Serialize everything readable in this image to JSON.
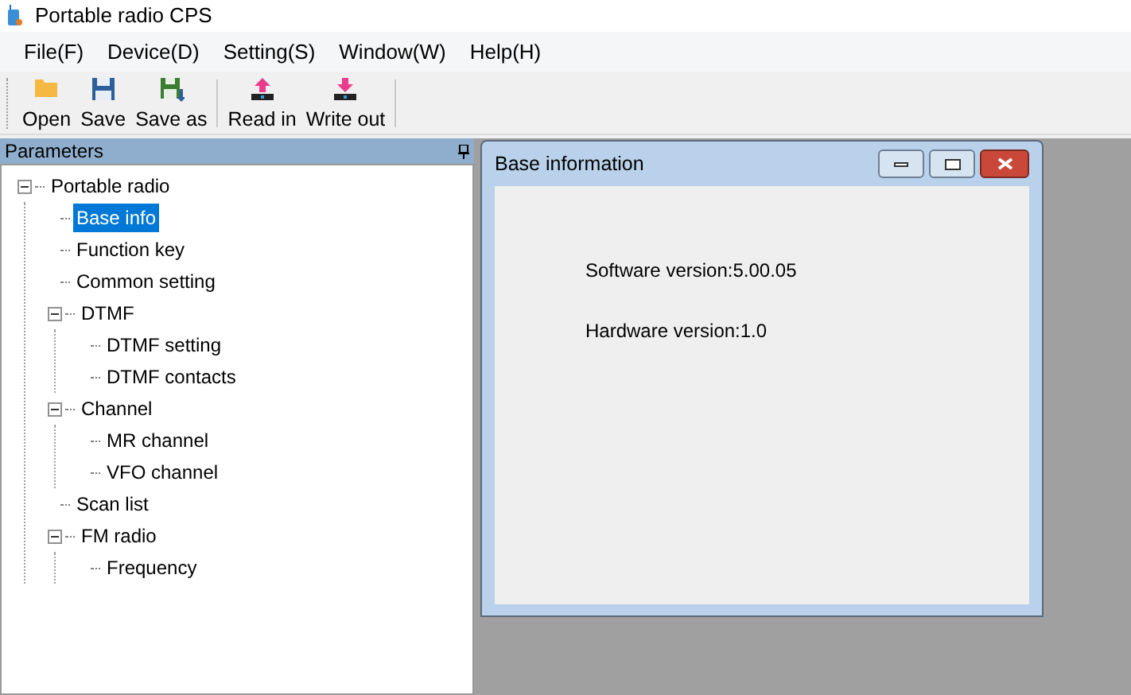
{
  "window": {
    "title": "Portable radio CPS"
  },
  "menu": [
    "File(F)",
    "Device(D)",
    "Setting(S)",
    "Window(W)",
    "Help(H)"
  ],
  "toolbar": [
    {
      "kind": "open",
      "label": "Open"
    },
    {
      "kind": "save",
      "label": "Save"
    },
    {
      "kind": "saveas",
      "label": "Save as"
    },
    {
      "kind": "separator"
    },
    {
      "kind": "readin",
      "label": "Read in"
    },
    {
      "kind": "writeout",
      "label": "Write out"
    },
    {
      "kind": "separator"
    }
  ],
  "parameters": {
    "title": "Parameters",
    "tree": [
      {
        "label": "Portable radio",
        "expanded": true,
        "selected": false,
        "children": [
          {
            "label": "Base info",
            "selected": true
          },
          {
            "label": "Function key",
            "selected": false
          },
          {
            "label": "Common setting",
            "selected": false
          },
          {
            "label": "DTMF",
            "expanded": true,
            "selected": false,
            "children": [
              {
                "label": "DTMF setting",
                "selected": false
              },
              {
                "label": "DTMF contacts",
                "selected": false
              }
            ]
          },
          {
            "label": "Channel",
            "expanded": true,
            "selected": false,
            "children": [
              {
                "label": "MR channel",
                "selected": false
              },
              {
                "label": "VFO channel",
                "selected": false
              }
            ]
          },
          {
            "label": "Scan list",
            "selected": false
          },
          {
            "label": "FM radio",
            "expanded": true,
            "selected": false,
            "children": [
              {
                "label": "Frequency",
                "selected": false
              }
            ]
          }
        ]
      }
    ]
  },
  "child_window": {
    "title": "Base information",
    "lines": [
      "Software version:5.00.05",
      "Hardware version:1.0"
    ]
  }
}
